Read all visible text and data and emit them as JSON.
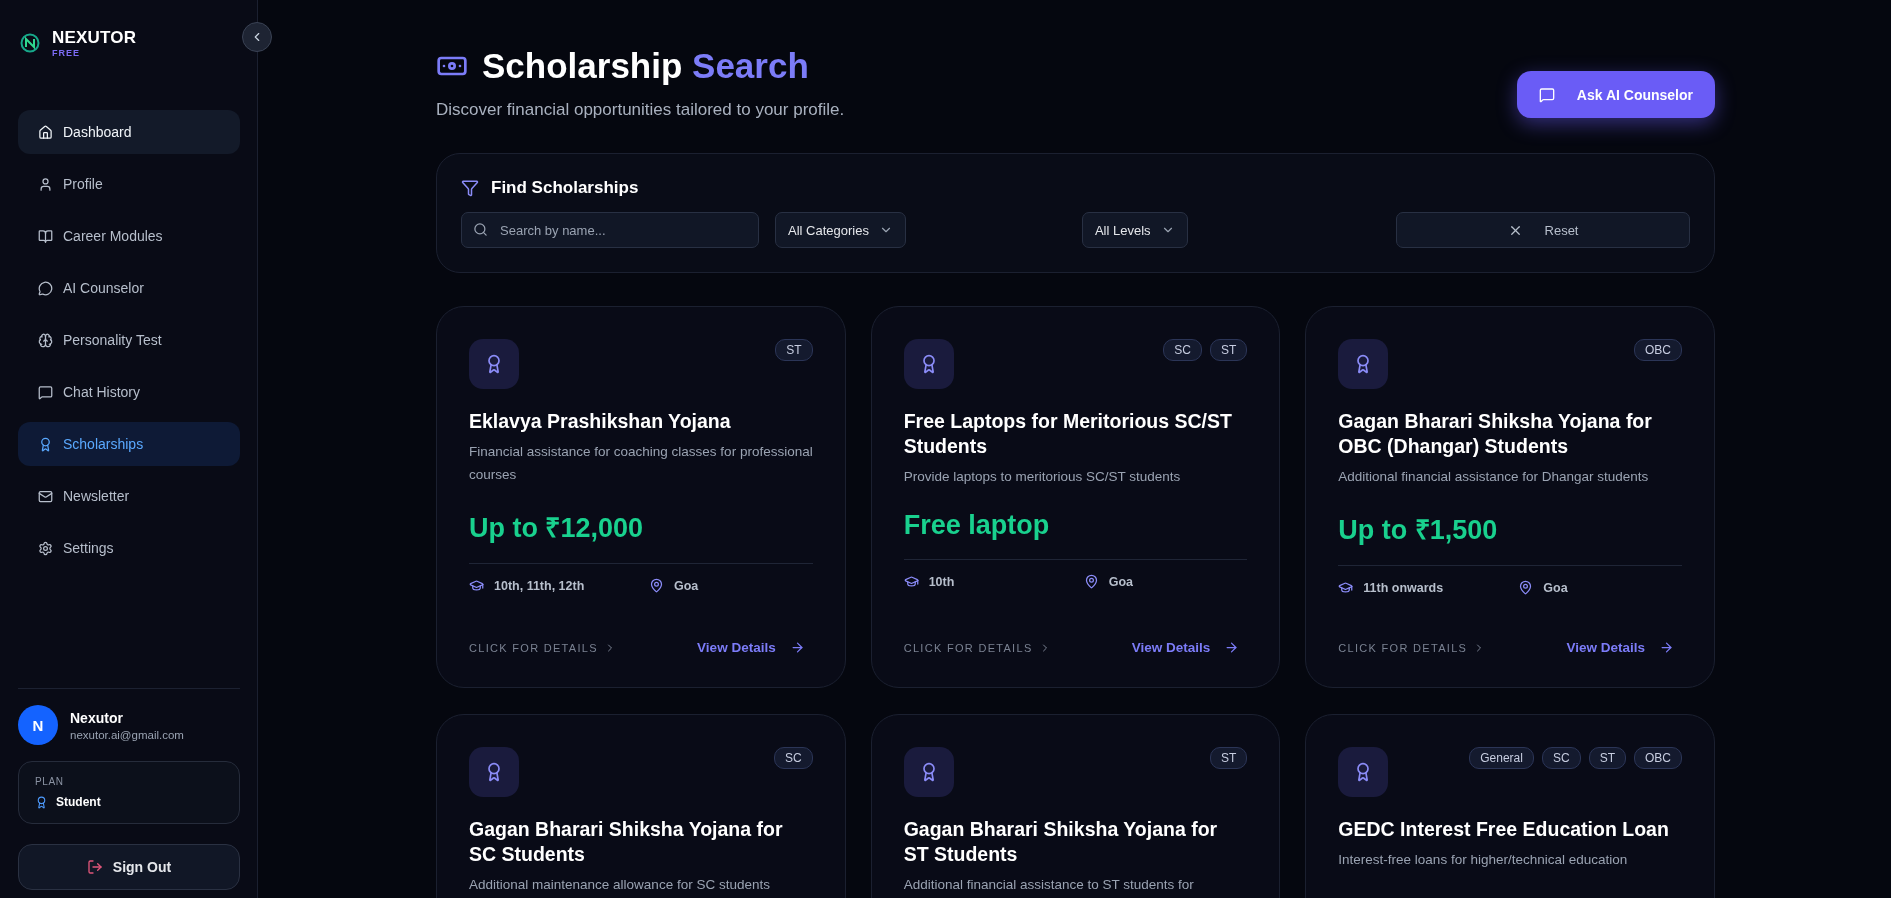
{
  "brand": {
    "name": "NEXUTOR",
    "tier": "FREE"
  },
  "nav": [
    {
      "label": "Dashboard",
      "selected": false,
      "hover": true
    },
    {
      "label": "Profile",
      "selected": false,
      "hover": false
    },
    {
      "label": "Career Modules",
      "selected": false,
      "hover": false
    },
    {
      "label": "AI Counselor",
      "selected": false,
      "hover": false
    },
    {
      "label": "Personality Test",
      "selected": false,
      "hover": false
    },
    {
      "label": "Chat History",
      "selected": false,
      "hover": false
    },
    {
      "label": "Scholarships",
      "selected": true,
      "hover": false
    },
    {
      "label": "Newsletter",
      "selected": false,
      "hover": false
    },
    {
      "label": "Settings",
      "selected": false,
      "hover": false
    }
  ],
  "user": {
    "initial": "N",
    "name": "Nexutor",
    "email": "nexutor.ai@gmail.com"
  },
  "plan": {
    "label": "PLAN",
    "value": "Student"
  },
  "sign_out": "Sign Out",
  "header": {
    "title": "Scholarship",
    "title_accent": "Search",
    "subtitle": "Discover financial opportunities tailored to your profile.",
    "action": "Ask AI Counselor"
  },
  "filters": {
    "title": "Find Scholarships",
    "search": {
      "placeholder": "Search by name..."
    },
    "category": "All Categories",
    "level": "All Levels",
    "reset": "Reset"
  },
  "cards": [
    {
      "tags": [
        "ST"
      ],
      "title": "Eklavya Prashikshan Yojana",
      "description": "Financial assistance for coaching classes for professional courses",
      "amount": "Up to ₹12,000",
      "eligibility": "10th, 11th, 12th",
      "location": "Goa",
      "hint": "CLICK FOR DETAILS",
      "action": "View Details"
    },
    {
      "tags": [
        "SC",
        "ST"
      ],
      "title": "Free Laptops for Meritorious SC/ST Students",
      "description": "Provide laptops to meritorious SC/ST students",
      "amount": "Free laptop",
      "eligibility": "10th",
      "location": "Goa",
      "hint": "CLICK FOR DETAILS",
      "action": "View Details"
    },
    {
      "tags": [
        "OBC"
      ],
      "title": "Gagan Bharari Shiksha Yojana for OBC (Dhangar) Students",
      "description": "Additional financial assistance for Dhangar students",
      "amount": "Up to ₹1,500",
      "eligibility": "11th onwards",
      "location": "Goa",
      "hint": "CLICK FOR DETAILS",
      "action": "View Details"
    },
    {
      "tags": [
        "SC"
      ],
      "title": "Gagan Bharari Shiksha Yojana for SC Students",
      "description": "Additional maintenance allowance for SC students"
    },
    {
      "tags": [
        "ST"
      ],
      "title": "Gagan Bharari Shiksha Yojana for ST Students",
      "description": "Additional financial assistance to ST students for"
    },
    {
      "tags": [
        "General",
        "SC",
        "ST",
        "OBC"
      ],
      "title": "GEDC Interest Free Education Loan",
      "description": "Interest-free loans for higher/technical education"
    }
  ]
}
